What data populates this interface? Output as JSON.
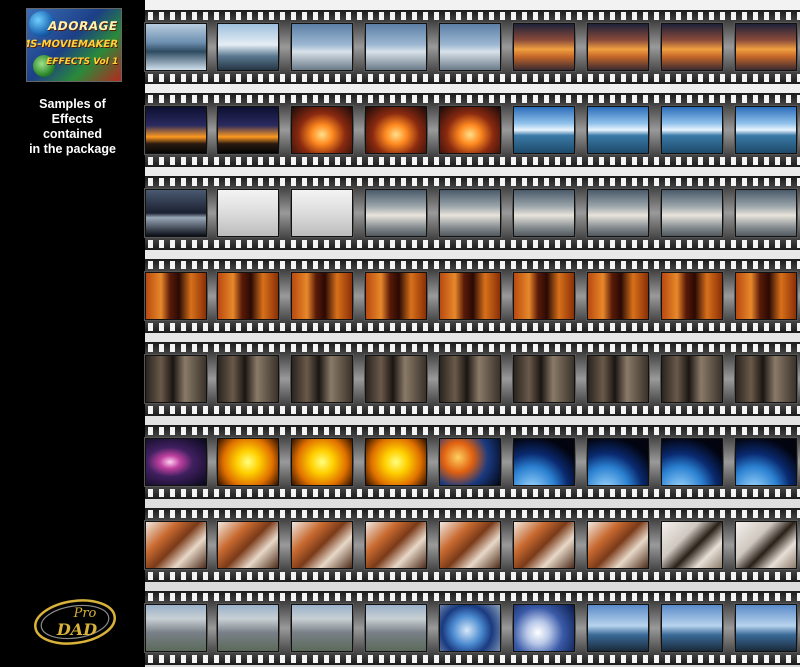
{
  "sidebar": {
    "product": {
      "line1": "ADORAGE",
      "line2": "MS-MOVIEMAKER",
      "line3": "EFFECTS Vol 1"
    },
    "samples_text": [
      "Samples of",
      "Effects",
      "contained",
      "in the package"
    ],
    "logo_text": {
      "top": "Pro",
      "bottom": "DAD"
    }
  },
  "strips": [
    {
      "name": "mountain-airplane",
      "frames": [
        "lake",
        "mountain",
        "plane",
        "plane",
        "plane",
        "sunset",
        "sunset",
        "sunset",
        "sunset"
      ]
    },
    {
      "name": "sunset-portal",
      "frames": [
        "dusk",
        "dusk",
        "portal",
        "portal",
        "portal",
        "beach",
        "beach",
        "beach",
        "beach"
      ]
    },
    {
      "name": "clouds",
      "frames": [
        "moonsea",
        "fog",
        "fog",
        "cloud",
        "cloud",
        "cloud",
        "cloud",
        "cloud",
        "cloud"
      ]
    },
    {
      "name": "fireplace-orange",
      "frames": [
        "fire",
        "fire",
        "fire",
        "fire",
        "fire",
        "fire",
        "fire",
        "fire",
        "fire"
      ]
    },
    {
      "name": "fireplace-dark",
      "frames": [
        "room",
        "room",
        "room",
        "room",
        "room",
        "room",
        "room",
        "room",
        "room"
      ]
    },
    {
      "name": "space-earth",
      "frames": [
        "galaxy",
        "sun",
        "sun",
        "sun",
        "burst",
        "earth",
        "earth",
        "earth",
        "earth"
      ]
    },
    {
      "name": "collage-dancer",
      "frames": [
        "collage",
        "collage",
        "collage",
        "collage",
        "collage",
        "collage",
        "collage",
        "dancer",
        "dancer"
      ]
    },
    {
      "name": "city-globe-palms",
      "frames": [
        "city",
        "city",
        "city",
        "city",
        "globe",
        "swirl",
        "palm",
        "palm",
        "palm"
      ]
    }
  ],
  "colors": {
    "background": "#000000",
    "film_light": "#f2f2f2",
    "film_dark": "#1b1b1b",
    "sidebar_text": "#ffffff",
    "logo_gold": "#d9b23a"
  }
}
